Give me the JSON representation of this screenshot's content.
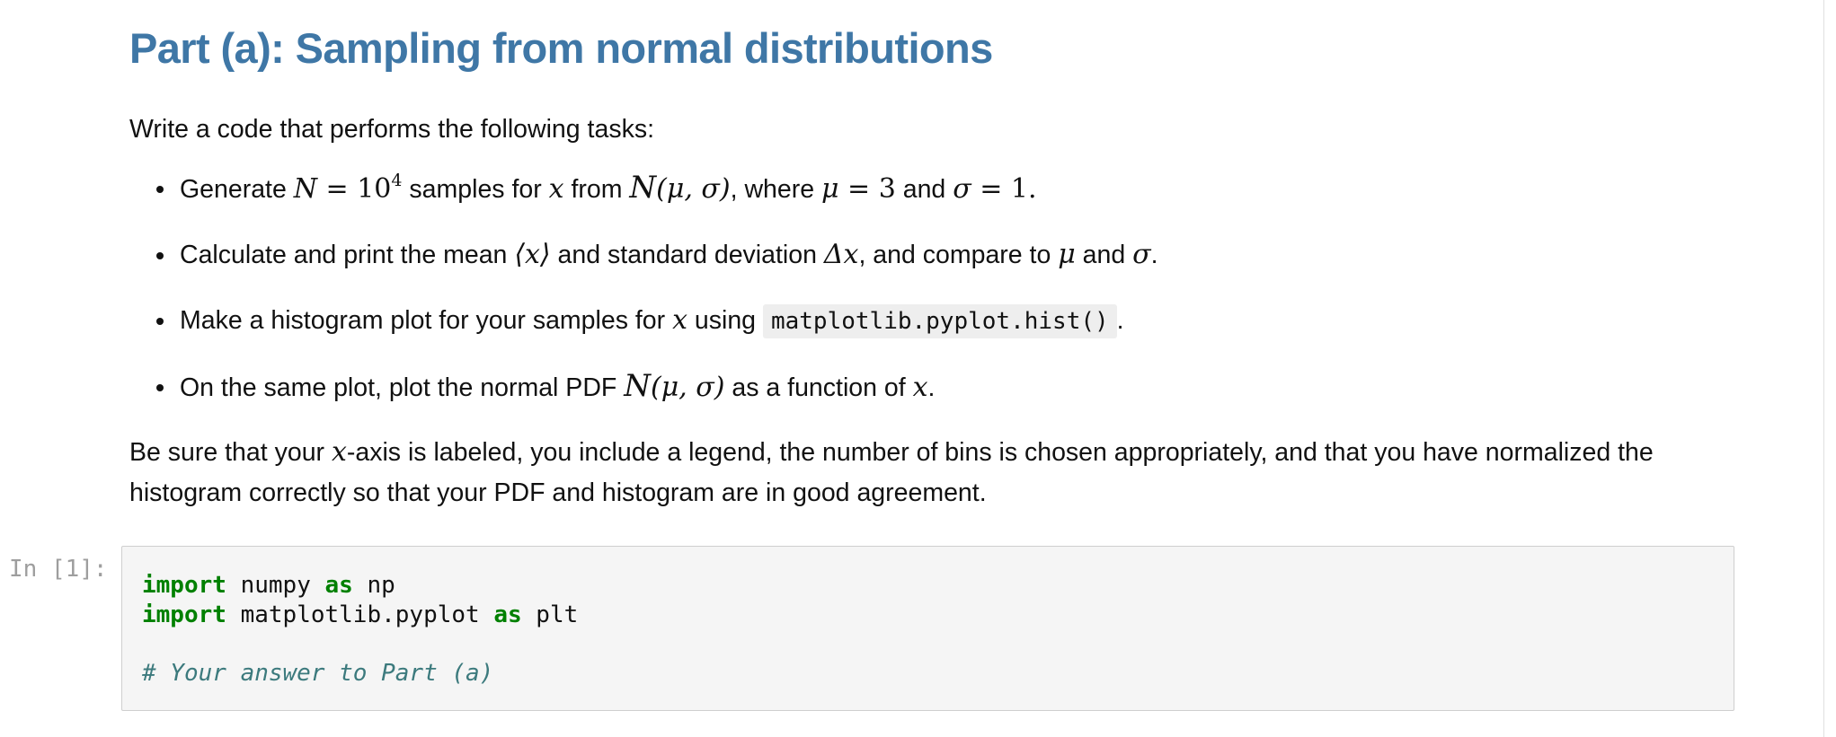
{
  "notebook": {
    "markdown": {
      "heading": "Part (a): Sampling from normal distributions",
      "intro": "Write a code that performs the following tasks:",
      "tasks": [
        {
          "t1": "Generate ",
          "m1": "N",
          "eq1": " = ",
          "num1": "10",
          "sup1": "4",
          "t2": " samples for ",
          "m2": "x",
          "t3": " from ",
          "cal": "N",
          "paren": "(μ, σ)",
          "t4": ", where ",
          "m3": "μ",
          "eq2": " = 3",
          "t5": " and ",
          "m4": "σ",
          "eq3": " = 1",
          "t6": "."
        },
        {
          "t1": "Calculate and print the mean ",
          "m1": "⟨x⟩",
          "t2": " and standard deviation ",
          "m2": "Δx",
          "t3": ", and compare to ",
          "m3": "μ",
          "t4": " and ",
          "m4": "σ",
          "t5": "."
        },
        {
          "t1": "Make a histogram plot for your samples for ",
          "m1": "x",
          "t2": " using ",
          "code": "matplotlib.pyplot.hist()",
          "t3": "."
        },
        {
          "t1": "On the same plot, plot the normal PDF ",
          "cal": "N",
          "paren": "(μ, σ)",
          "t2": " as a function of ",
          "m1": "x",
          "t3": "."
        }
      ],
      "closing": {
        "t1": "Be sure that your ",
        "m1": "x",
        "t2": "-axis is labeled, you include a legend, the number of bins is chosen appropriately, and that you have normalized the histogram correctly so that your PDF and histogram are in good agreement."
      }
    },
    "code_cell": {
      "prompt": "In [1]:",
      "lines": [
        {
          "kw1": "import",
          "t1": " numpy ",
          "kw2": "as",
          "t2": " np"
        },
        {
          "kw1": "import",
          "t1": " matplotlib.pyplot ",
          "kw2": "as",
          "t2": " plt"
        },
        {
          "comment": "# Your answer to Part (a)"
        }
      ]
    }
  },
  "colors": {
    "heading": "#3f77a6",
    "keyword": "#008000",
    "comment": "#3c7a7d",
    "prompt": "#9e9e9e",
    "code_bg": "#f5f5f5"
  }
}
